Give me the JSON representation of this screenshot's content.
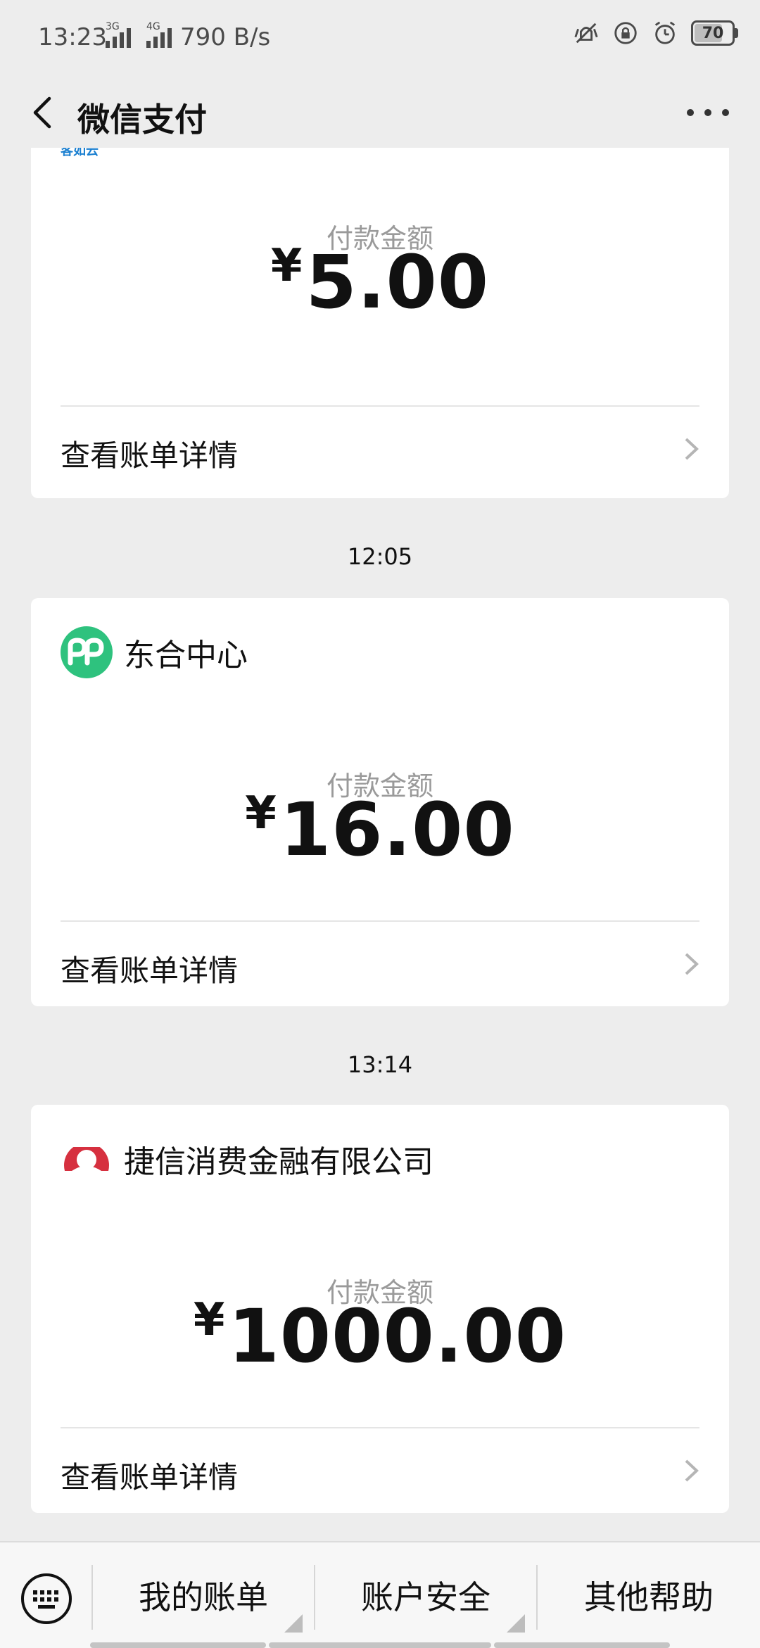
{
  "status_bar": {
    "time": "13:23",
    "net_type_1": "3G",
    "net_type_2": "4G",
    "net_speed": "790 B/s",
    "battery": "70"
  },
  "header": {
    "title": "微信支付"
  },
  "transactions": [
    {
      "merchant": "",
      "amount_label": "付款金额",
      "currency": "¥",
      "amount": "5.00",
      "detail_label": "查看账单详情",
      "logo_text": "客如云"
    },
    {
      "time": "12:05",
      "merchant": "东合中心",
      "amount_label": "付款金额",
      "currency": "¥",
      "amount": "16.00",
      "detail_label": "查看账单详情",
      "logo_color": "#2ec27e"
    },
    {
      "time": "13:14",
      "merchant": "捷信消费金融有限公司",
      "amount_label": "付款金额",
      "currency": "¥",
      "amount": "1000.00",
      "detail_label": "查看账单详情",
      "logo_color": "#d6303f"
    }
  ],
  "bottom_menu": {
    "items": [
      "我的账单",
      "账户安全",
      "其他帮助"
    ]
  }
}
